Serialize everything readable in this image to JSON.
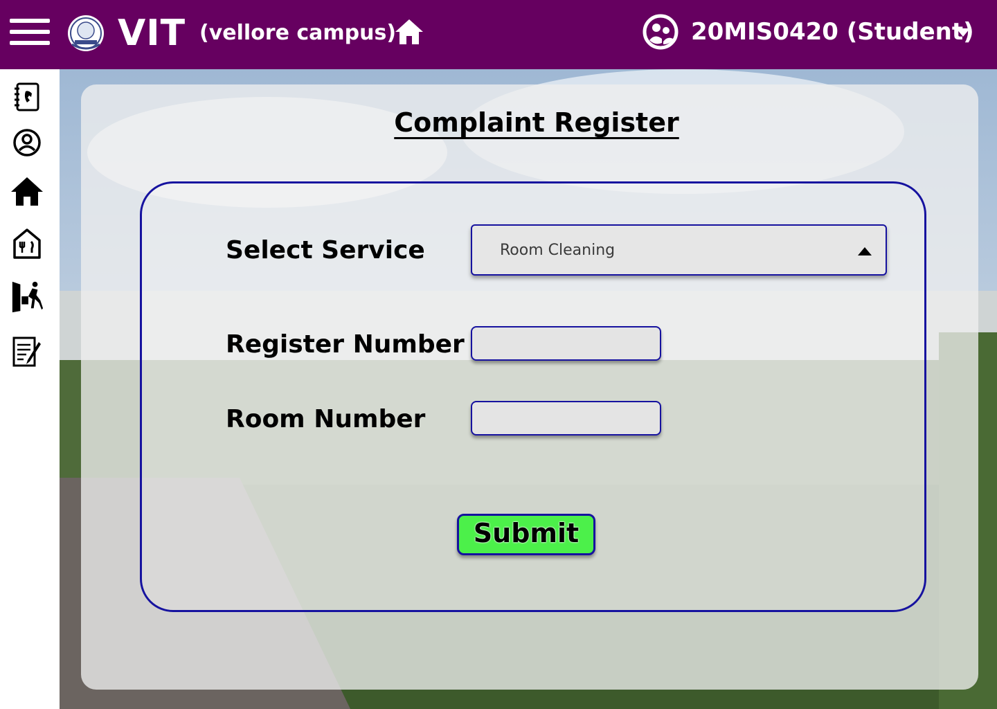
{
  "header": {
    "brand": "VIT",
    "campus": "(vellore campus)",
    "user": "20MIS0420 (Student)",
    "background_color": "#660060"
  },
  "sidebar": {
    "items": [
      {
        "icon": "contacts-book-icon"
      },
      {
        "icon": "user-circle-icon"
      },
      {
        "icon": "home-icon"
      },
      {
        "icon": "mess-restaurant-icon"
      },
      {
        "icon": "leave-exit-icon"
      },
      {
        "icon": "complaint-form-icon"
      }
    ]
  },
  "page": {
    "title": "Complaint Register"
  },
  "form": {
    "service_label": "Select Service",
    "service_value": "Room Cleaning",
    "register_label": "Register Number",
    "register_value": "",
    "room_label": "Room Number",
    "room_value": "",
    "submit_label": "Submit"
  },
  "colors": {
    "accent_border": "#16129f",
    "submit_green": "#4cf04a"
  }
}
